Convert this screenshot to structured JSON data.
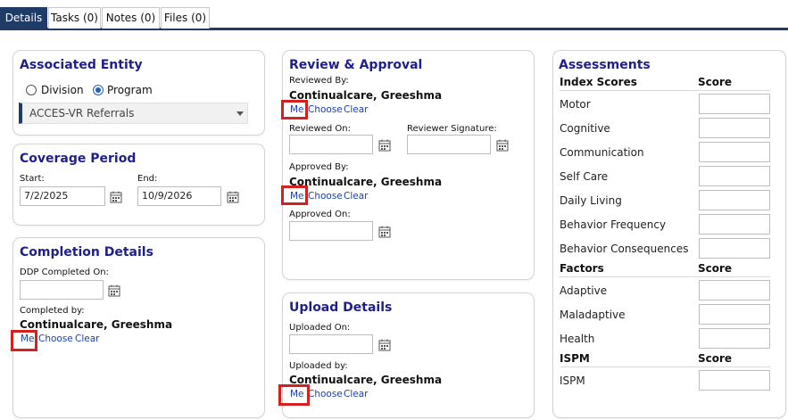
{
  "tabs": [
    {
      "label": "Details"
    },
    {
      "label": "Tasks (0)"
    },
    {
      "label": "Notes (0)"
    },
    {
      "label": "Files (0)"
    }
  ],
  "associated_entity": {
    "title": "Associated Entity",
    "radio_division": "Division",
    "radio_program": "Program",
    "selected": "Program",
    "dropdown_value": "ACCES-VR Referrals"
  },
  "coverage_period": {
    "title": "Coverage Period",
    "start_label": "Start:",
    "start_value": "7/2/2025",
    "end_label": "End:",
    "end_value": "10/9/2026"
  },
  "completion_details": {
    "title": "Completion Details",
    "ddp_label": "DDP Completed On:",
    "ddp_value": "",
    "completed_by_label": "Completed by:",
    "completed_by_name": "Continualcare, Greeshma",
    "me": "Me",
    "choose": "Choose",
    "clear": "Clear"
  },
  "review_approval": {
    "title": "Review & Approval",
    "reviewed_by_label": "Reviewed By:",
    "reviewed_by_name": "Continualcare, Greeshma",
    "me": "Me",
    "choose": "Choose",
    "clear": "Clear",
    "reviewed_on_label": "Reviewed On:",
    "reviewer_signature_label": "Reviewer Signature:",
    "approved_by_label": "Approved By:",
    "approved_by_name": "Continualcare, Greeshma",
    "approved_on_label": "Approved On:"
  },
  "upload_details": {
    "title": "Upload Details",
    "uploaded_on_label": "Uploaded On:",
    "uploaded_by_label": "Uploaded by:",
    "uploaded_by_name": "Continualcare, Greeshma",
    "me": "Me",
    "choose": "Choose",
    "clear": "Clear"
  },
  "assessments": {
    "title": "Assessments",
    "score_header": "Score",
    "index_scores_header": "Index Scores",
    "index_scores": [
      "Motor",
      "Cognitive",
      "Communication",
      "Self Care",
      "Daily Living",
      "Behavior Frequency",
      "Behavior Consequences"
    ],
    "factors_header": "Factors",
    "factors": [
      "Adaptive",
      "Maladaptive",
      "Health"
    ],
    "ispm_header": "ISPM",
    "ispm": [
      "ISPM"
    ]
  },
  "colors": {
    "tab_active": "#1f3b66",
    "title_text": "#1f1f8a",
    "link": "#1a3fb0",
    "highlight": "#d61f1f"
  }
}
